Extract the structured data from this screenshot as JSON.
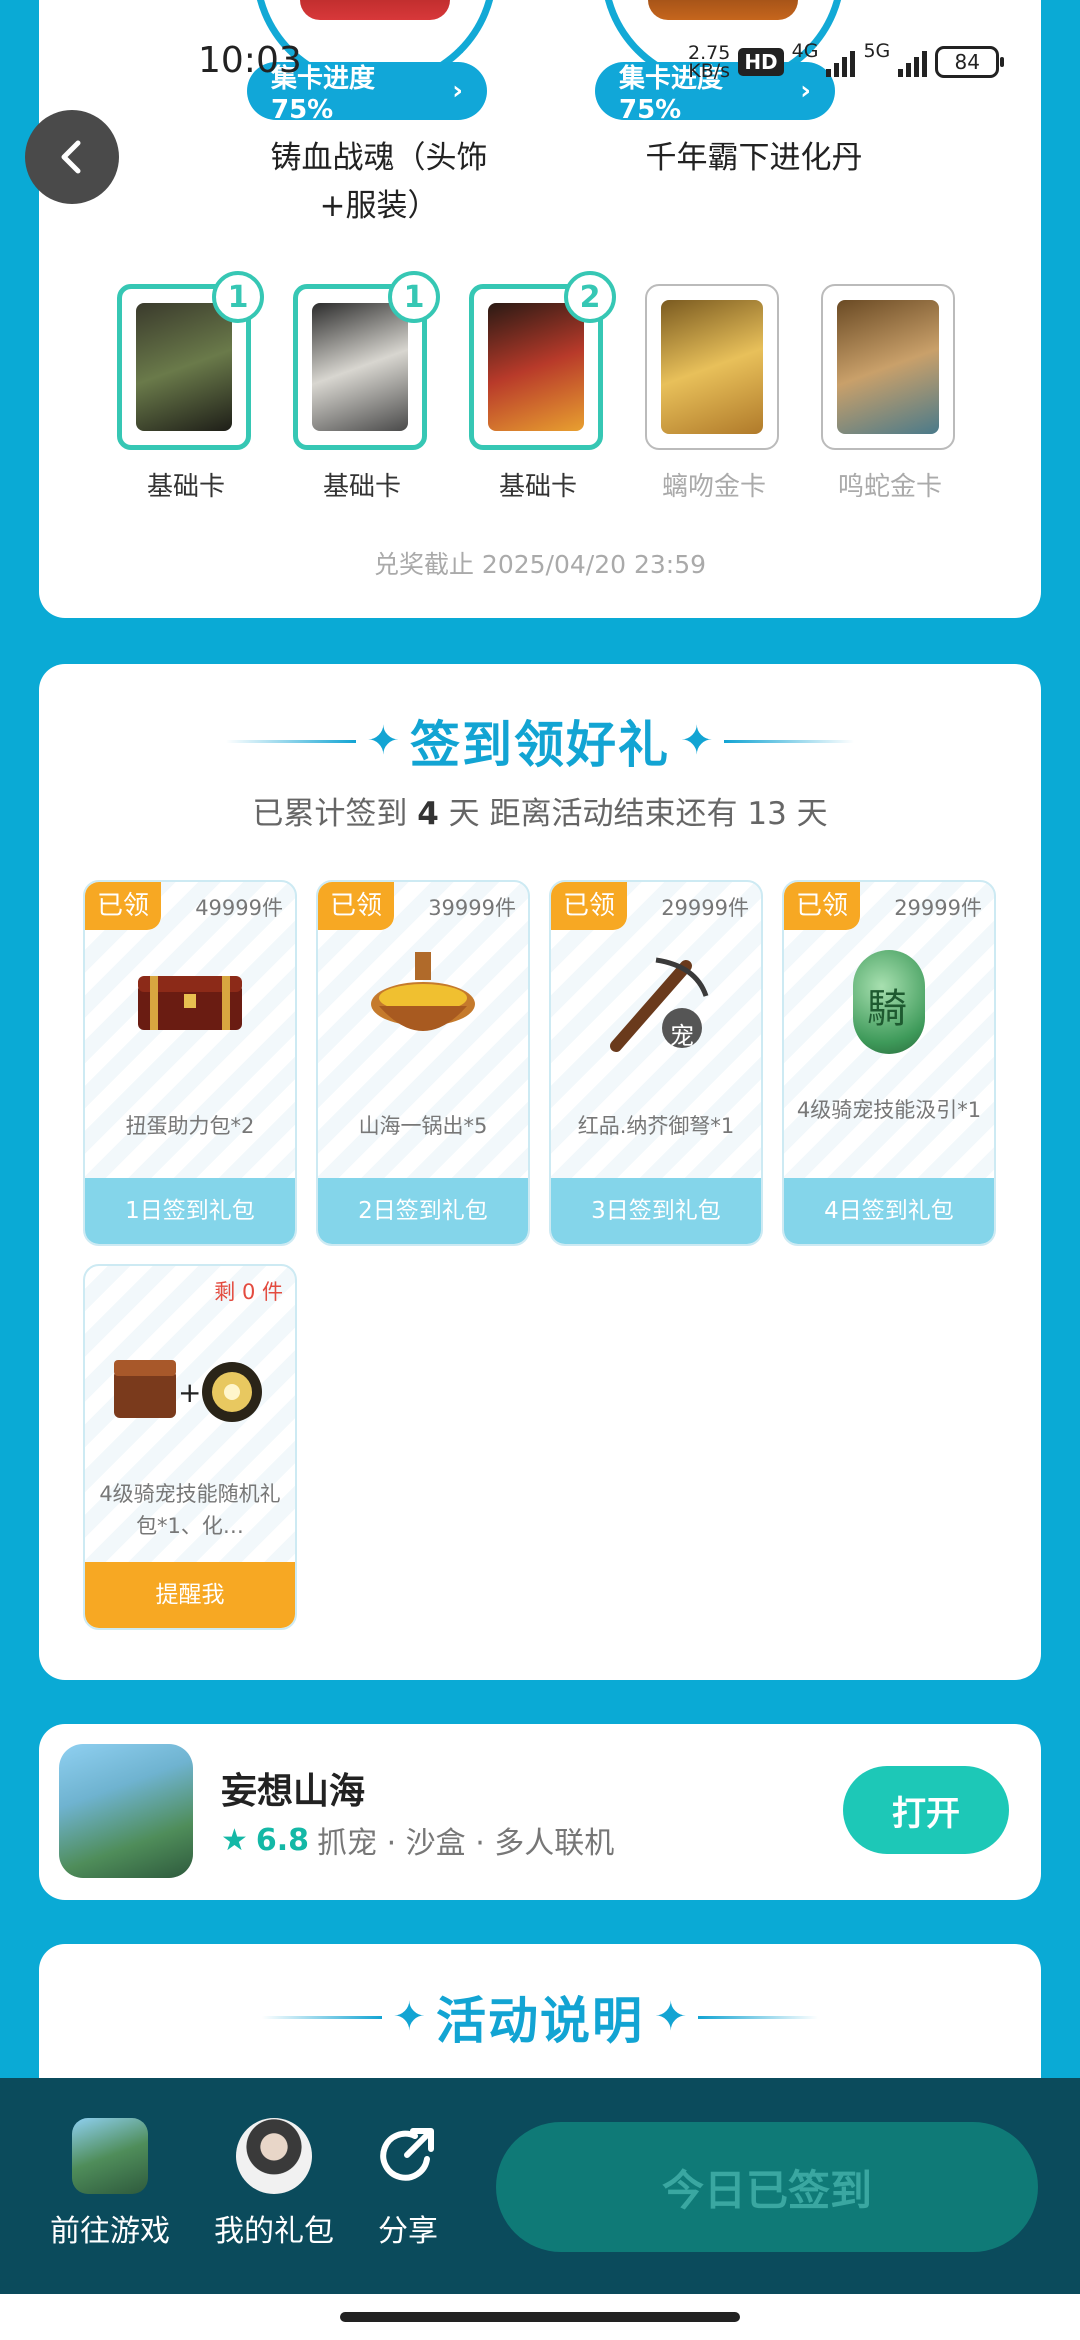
{
  "status_bar": {
    "time": "10:03",
    "net_speed_value": "2.75",
    "net_speed_unit": "KB/s",
    "hd": "HD",
    "net1": "4G",
    "net2": "5G",
    "battery": "84"
  },
  "rewards": [
    {
      "progress": "集卡进度 75%",
      "name_line1": "铸血战魂（头饰",
      "name_line2": "+服装）"
    },
    {
      "progress": "集卡进度 75%",
      "name_line1": "千年霸下进化丹"
    }
  ],
  "cards": [
    {
      "label": "基础卡",
      "count": "1",
      "owned": true
    },
    {
      "label": "基础卡",
      "count": "1",
      "owned": true
    },
    {
      "label": "基础卡",
      "count": "2",
      "owned": true
    },
    {
      "label": "螭吻金卡",
      "owned": false
    },
    {
      "label": "鸣蛇金卡",
      "owned": false
    }
  ],
  "deadline": "兑奖截止 2025/04/20 23:59",
  "signin": {
    "title": "签到领好礼",
    "summary_a": "已累计签到",
    "days_done": "4",
    "summary_b": "天   距离活动结束还有 13 天",
    "gifts": [
      {
        "tag": "已领",
        "stock": "49999件",
        "name": "扭蛋助力包*2",
        "button": "1日签到礼包"
      },
      {
        "tag": "已领",
        "stock": "39999件",
        "name": "山海一锅出*5",
        "button": "2日签到礼包"
      },
      {
        "tag": "已领",
        "stock": "29999件",
        "name": "红品.纳芥御弩*1",
        "button": "3日签到礼包",
        "badge": "宠"
      },
      {
        "tag": "已领",
        "stock": "29999件",
        "name": "4级骑宠技能汲引*1",
        "button": "4日签到礼包",
        "seal": "騎"
      },
      {
        "stock": "剩 0 件",
        "name": "4级骑宠技能随机礼包*1、化…",
        "button": "提醒我"
      }
    ]
  },
  "game": {
    "name": "妄想山海",
    "score": "6.8",
    "tags": "抓宠 · 沙盒 · 多人联机",
    "open": "打开"
  },
  "activity": {
    "title": "活动说明"
  },
  "bottom_bar": {
    "go_game": "前往游戏",
    "my_gifts": "我的礼包",
    "share": "分享",
    "checked_in": "今日已签到"
  },
  "colors": {
    "background": "#0aaad5",
    "accent": "#12a4d3",
    "teal": "#36c7b4",
    "orange": "#f7a823"
  }
}
